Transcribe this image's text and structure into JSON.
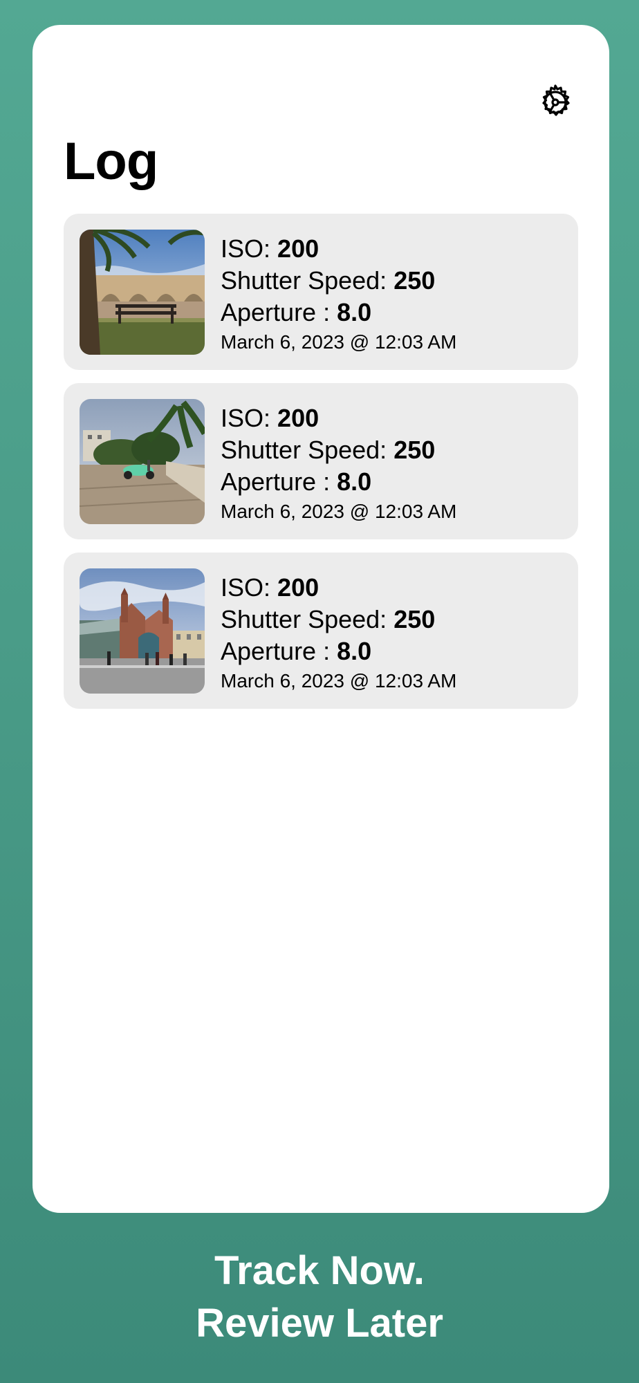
{
  "page": {
    "title": "Log"
  },
  "header": {
    "settings_icon": "gear-icon"
  },
  "log_entries": [
    {
      "iso_label": "ISO:",
      "iso_value": "200",
      "shutter_label": "Shutter Speed:",
      "shutter_value": "250",
      "aperture_label": "Aperture :",
      "aperture_value": "8.0",
      "date": "March 6, 2023 @ 12:03 AM",
      "photo": "bench-by-river-photo"
    },
    {
      "iso_label": "ISO:",
      "iso_value": "200",
      "shutter_label": "Shutter Speed:",
      "shutter_value": "250",
      "aperture_label": "Aperture :",
      "aperture_value": "8.0",
      "date": "March 6, 2023 @ 12:03 AM",
      "photo": "scooter-street-photo"
    },
    {
      "iso_label": "ISO:",
      "iso_value": "200",
      "shutter_label": "Shutter Speed:",
      "shutter_value": "250",
      "aperture_label": "Aperture :",
      "aperture_value": "8.0",
      "date": "March 6, 2023 @ 12:03 AM",
      "photo": "market-building-photo"
    }
  ],
  "tagline": {
    "line1": "Track Now.",
    "line2": "Review Later"
  },
  "colors": {
    "background_top": "#53a893",
    "background_bottom": "#3c8a79",
    "card": "#ffffff",
    "entry_bg": "#ececec",
    "text": "#000000"
  }
}
